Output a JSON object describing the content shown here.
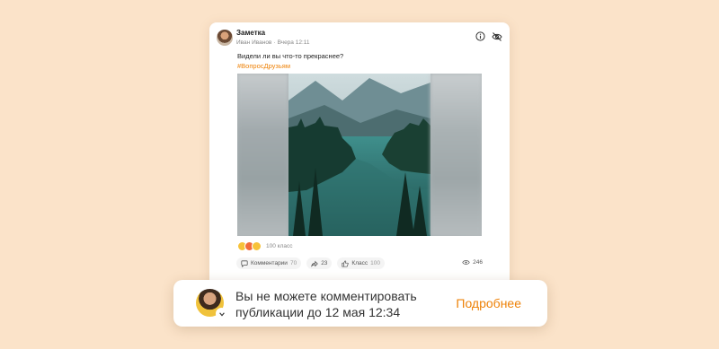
{
  "post": {
    "title": "Заметка",
    "author": "Иван Иванов",
    "separator": "·",
    "time": "Вчера 12:11",
    "text": "Видели ли вы что-то прекраснее?",
    "hashtag": "#ВопросДрузьям",
    "reactions_count": "100 класс",
    "comments_label": "Комментарии",
    "comments_count": "70",
    "shares_count": "23",
    "likes_label": "Класс",
    "likes_count": "100",
    "views_count": "246"
  },
  "toast": {
    "message_line1": "Вы не можете комментировать",
    "message_line2": "публикации до 12 мая 12:34",
    "link_label": "Подробнее"
  },
  "colors": {
    "background": "#fbe3c9",
    "accent": "#ee8208",
    "card": "#ffffff"
  },
  "icons": [
    "info-icon",
    "eye-off-icon",
    "comment-icon",
    "share-icon",
    "like-icon",
    "views-icon",
    "check-icon"
  ]
}
